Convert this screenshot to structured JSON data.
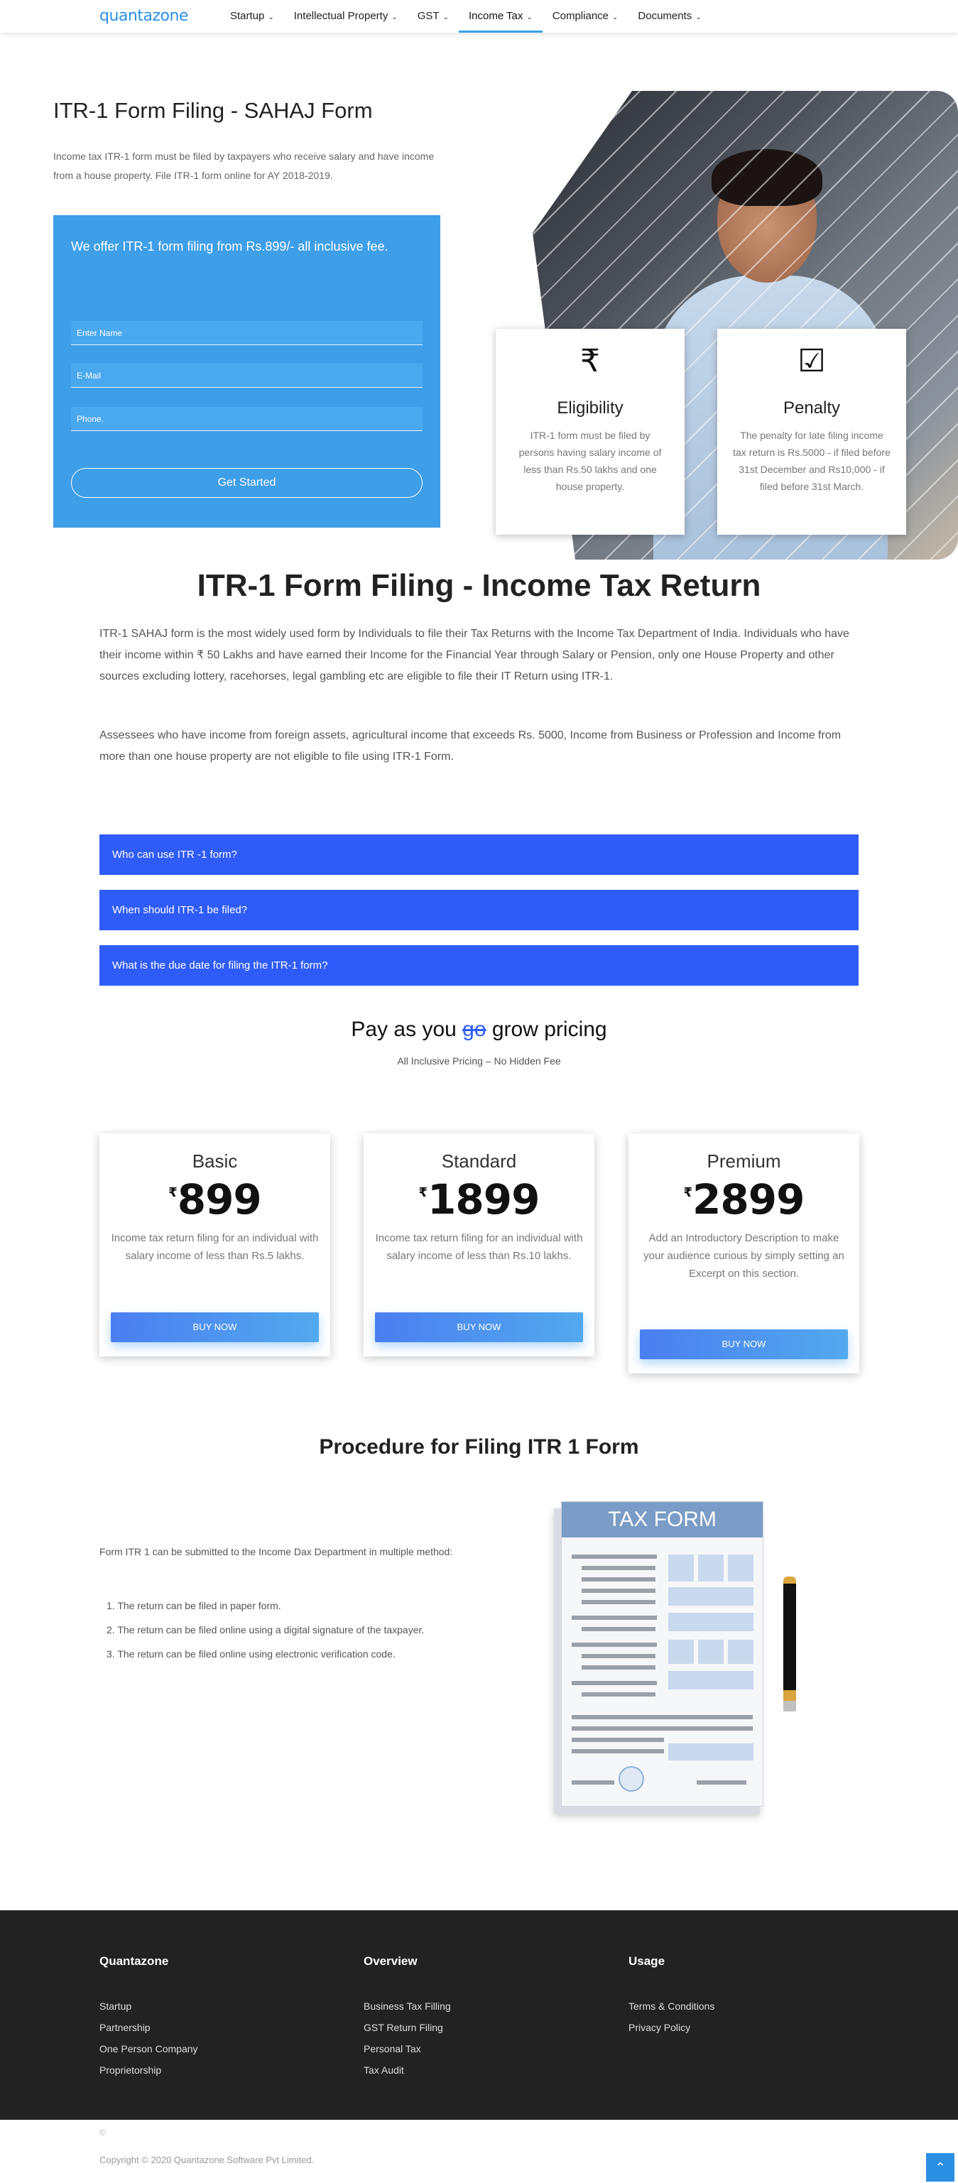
{
  "nav": {
    "logo": "quantazone",
    "items": [
      {
        "label": "Startup"
      },
      {
        "label": "Intellectual Property"
      },
      {
        "label": "GST"
      },
      {
        "label": "Income Tax"
      },
      {
        "label": "Compliance"
      },
      {
        "label": "Documents"
      }
    ],
    "active": "Income Tax"
  },
  "hero": {
    "title": "ITR-1 Form Filing - SAHAJ Form",
    "subtitle": "Income tax ITR-1 form must be filed by taxpayers who receive salary and have income from a house property. File ITR-1 form online for AY 2018-2019.",
    "form": {
      "offer": "We offer ITR-1 form filing from Rs.899/- all inclusive fee.",
      "name_placeholder": "Enter Name",
      "email_placeholder": "E-Mail",
      "phone_placeholder": "Phone.",
      "submit_label": "Get Started"
    },
    "cards": [
      {
        "icon": "rupee-icon",
        "glyph": "₹",
        "title": "Eligibility",
        "text": "ITR-1 form must be filed by persons having salary income of less than Rs.50 lakhs and one house property."
      },
      {
        "icon": "checkbox-icon",
        "glyph": "☑",
        "title": "Penalty",
        "text": "The penalty for late filing income tax return is Rs.5000 - if filed before 31st December and Rs10,000 - if filed before 31st March."
      }
    ]
  },
  "main": {
    "title": "ITR-1 Form Filing - Income Tax Return",
    "para1": "ITR-1 SAHAJ form is the most widely used form by Individuals to file their Tax Returns with the Income Tax Department of India. Individuals who have their income within ₹ 50 Lakhs and have earned their Income for the Financial Year through Salary or Pension, only one House Property and other sources excluding lottery, racehorses, legal gambling etc are eligible to file their IT Return using ITR-1.",
    "para2": "Assessees who have income from foreign assets, agricultural income that exceeds Rs. 5000, Income from Business or Profession and Income from more than one house property are not eligible to file using ITR-1 Form.",
    "faqs": [
      {
        "question": "Who can use ITR -1 form?"
      },
      {
        "question": "When should ITR-1 be filed?"
      },
      {
        "question": "What is the due date for filing the ITR-1 form?"
      }
    ]
  },
  "pricing": {
    "title_pre": "Pay as you ",
    "title_strike": "go",
    "title_post": " grow pricing",
    "subtitle": "All Inclusive Pricing – No Hidden Fee",
    "plans": [
      {
        "name": "Basic",
        "currency": "₹",
        "price": "899",
        "description": "Income tax return filing for an individual with salary income of less than Rs.5 lakhs.",
        "button": "BUY NOW"
      },
      {
        "name": "Standard",
        "currency": "₹",
        "price": "1899",
        "description": "Income tax return filing for an individual with salary income of less than Rs.10 lakhs.",
        "button": "BUY NOW"
      },
      {
        "name": "Premium",
        "currency": "₹",
        "price": "2899",
        "description": "Add an Introductory Description to make your audience curious by simply setting an Excerpt on this section.",
        "button": "BUY NOW"
      }
    ]
  },
  "procedure": {
    "title": "Procedure for Filing ITR 1 Form",
    "intro": "Form ITR 1 can be submitted to the Income Dax Department in multiple method:",
    "steps": [
      "1. The return can be filed in paper form.",
      "2. The return can be filed online using a digital signature of the taxpayer.",
      "3. The return can be filed online using electronic verification code."
    ],
    "image_label": "TAX FORM"
  },
  "footer": {
    "columns": [
      {
        "heading": "Quantazone",
        "links": [
          "Startup",
          "Partnership",
          "One Person Company",
          "Proprietorship"
        ]
      },
      {
        "heading": "Overview",
        "links": [
          "Business Tax Filling",
          "GST Return Filing",
          "Personal Tax",
          "Tax Audit"
        ]
      },
      {
        "heading": "Usage",
        "links": [
          "Terms & Conditions",
          "Privacy Policy"
        ]
      }
    ],
    "mark": "©",
    "copyright": "Copyright © 2020 Quantazone Software Pvt Limited.",
    "scroll_top_icon": "chevron-up-icon"
  }
}
